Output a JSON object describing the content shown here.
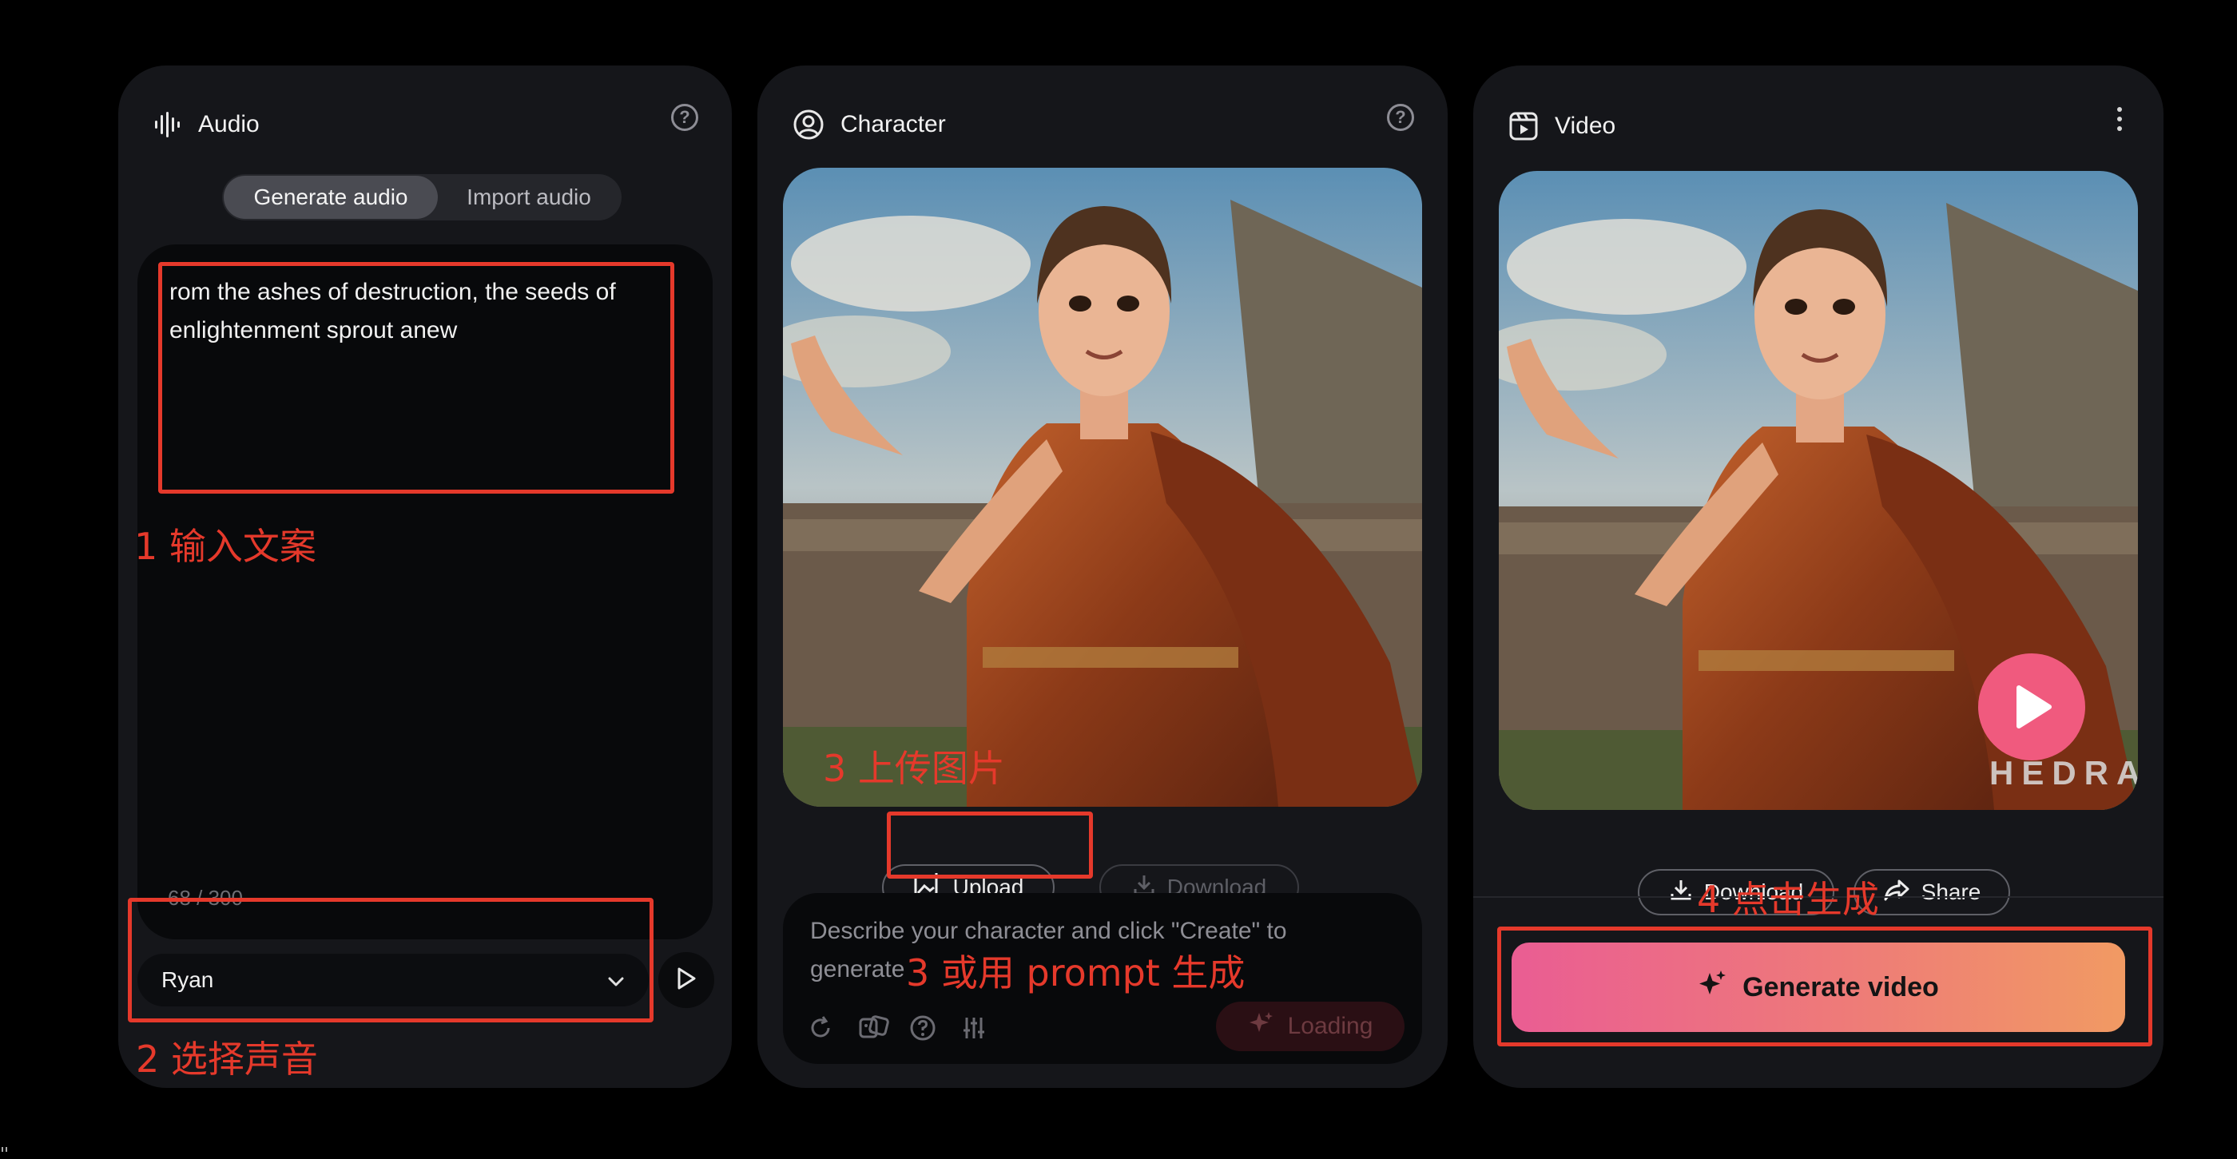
{
  "audio_panel": {
    "title": "Audio",
    "icon": "waveform-icon",
    "tabs": [
      {
        "label": "Generate audio",
        "active": true
      },
      {
        "label": "Import audio",
        "active": false
      }
    ],
    "text_value": "rom the ashes of destruction, the seeds of enlightenment sprout anew",
    "char_count": "68 / 300",
    "voice": "Ryan"
  },
  "character_panel": {
    "title": "Character",
    "icon": "user-circle-icon",
    "upload_label": "Upload",
    "download_label": "Download",
    "prompt_placeholder": "Describe your character and click \"Create\" to generate",
    "loading_label": "Loading"
  },
  "video_panel": {
    "title": "Video",
    "icon": "video-icon",
    "download_label": "Download",
    "share_label": "Share",
    "generate_label": "Generate video",
    "watermark": "HEDRA"
  },
  "annotations": {
    "step1": "1 输入文案",
    "step2": "2 选择声音",
    "step3a": "3 上传图片",
    "step3b": "3 或用 prompt 生成",
    "step4": "4 点击生成"
  },
  "colors": {
    "annotation": "#e5392b",
    "panel_bg": "#15161a",
    "gradient_start": "#ea5d93",
    "gradient_end": "#f19a63"
  }
}
